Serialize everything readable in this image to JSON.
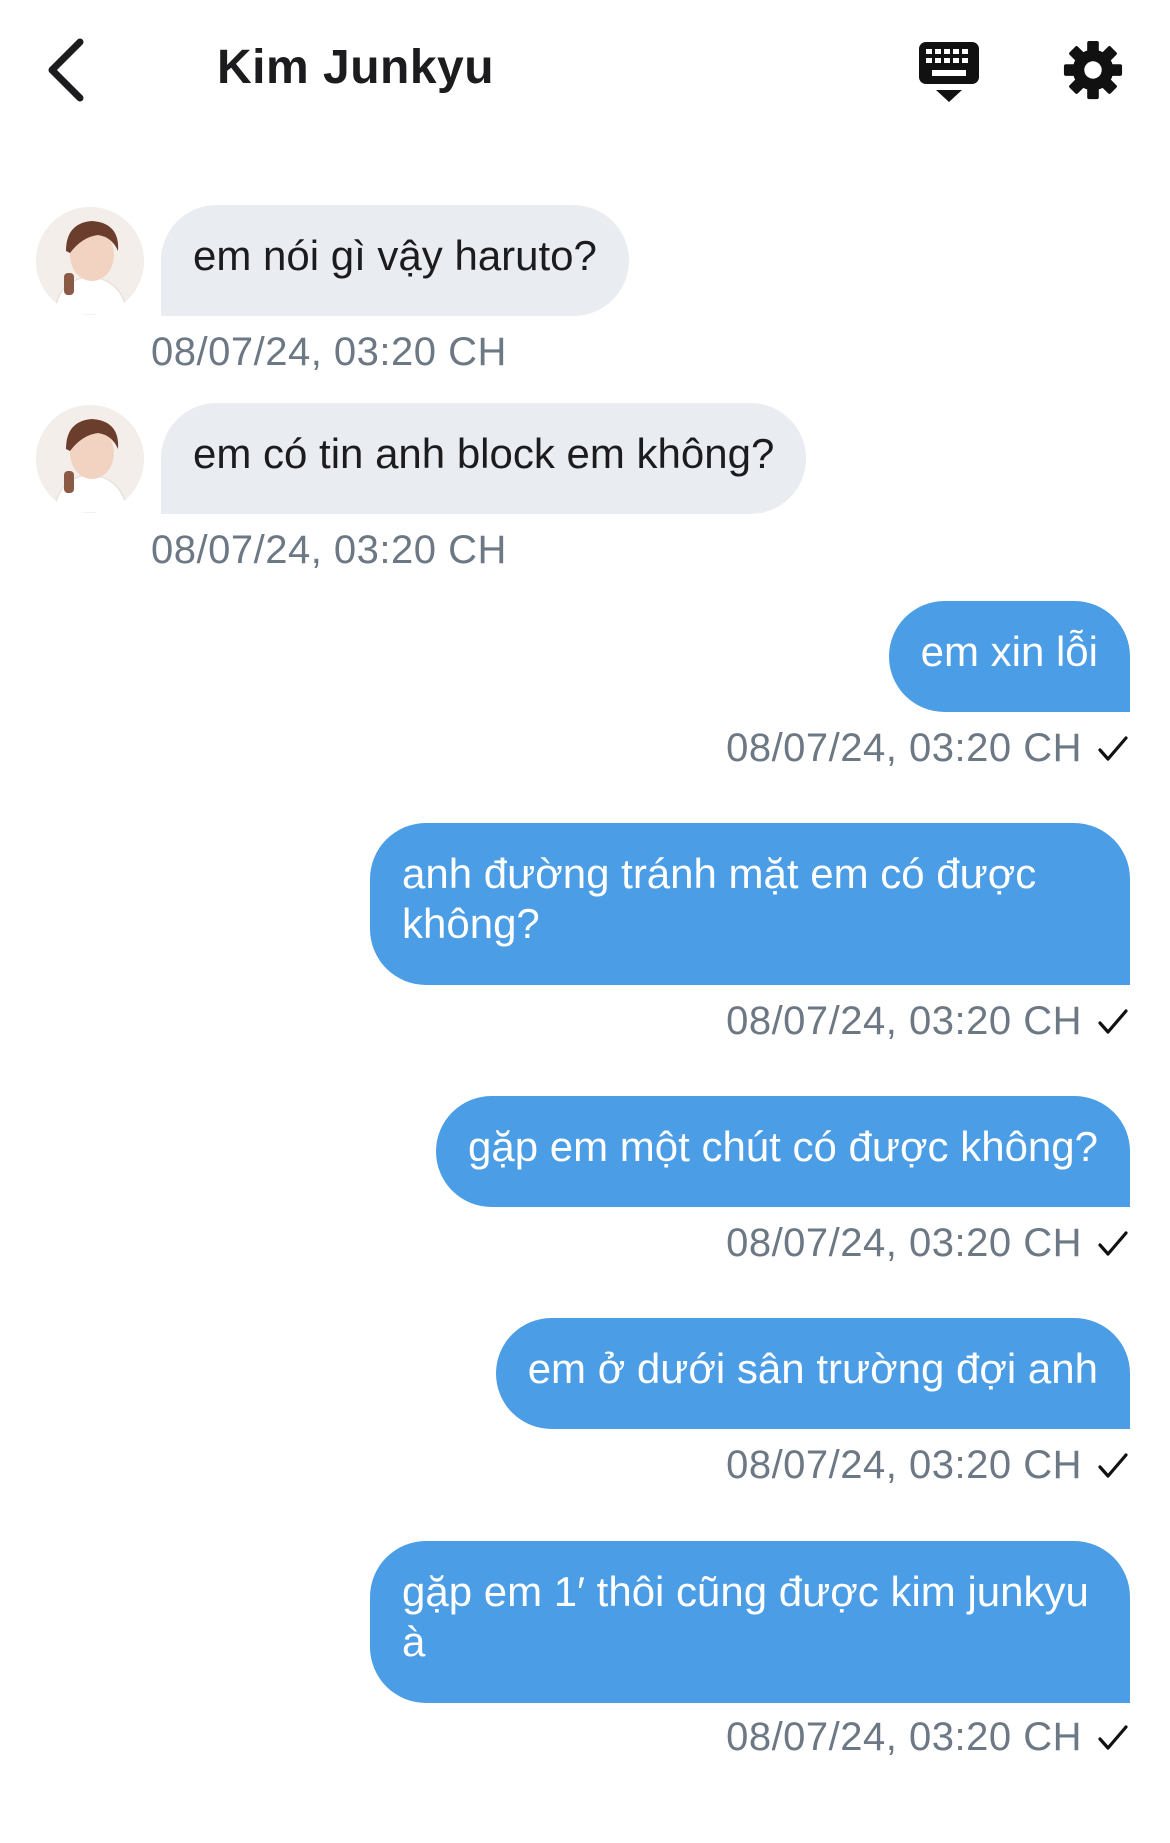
{
  "header": {
    "title": "Kim Junkyu"
  },
  "icons": {
    "back": "chevron-left-icon",
    "keyboard": "keyboard-icon",
    "settings": "gear-icon",
    "read": "checkmark-icon"
  },
  "colors": {
    "outgoing_bubble": "#4b9de6",
    "incoming_bubble": "#e9ecf1",
    "timestamp": "#6d7885"
  },
  "messages": [
    {
      "direction": "incoming",
      "text": "em nói gì vậy haruto?",
      "time": "08/07/24, 03:20 CH"
    },
    {
      "direction": "incoming",
      "text": "em có tin anh block em không?",
      "time": "08/07/24, 03:20 CH"
    },
    {
      "direction": "outgoing",
      "text": "em xin lỗi",
      "time": "08/07/24, 03:20 CH"
    },
    {
      "direction": "outgoing",
      "text": "anh đường tránh mặt em có được không?",
      "time": "08/07/24, 03:20 CH"
    },
    {
      "direction": "outgoing",
      "text": "gặp em một chút có được không?",
      "time": "08/07/24, 03:20 CH"
    },
    {
      "direction": "outgoing",
      "text": "em ở dưới sân trường đợi anh",
      "time": "08/07/24, 03:20 CH"
    },
    {
      "direction": "outgoing",
      "text": "gặp em 1′ thôi cũng được kim junkyu à",
      "time": "08/07/24, 03:20 CH"
    }
  ]
}
